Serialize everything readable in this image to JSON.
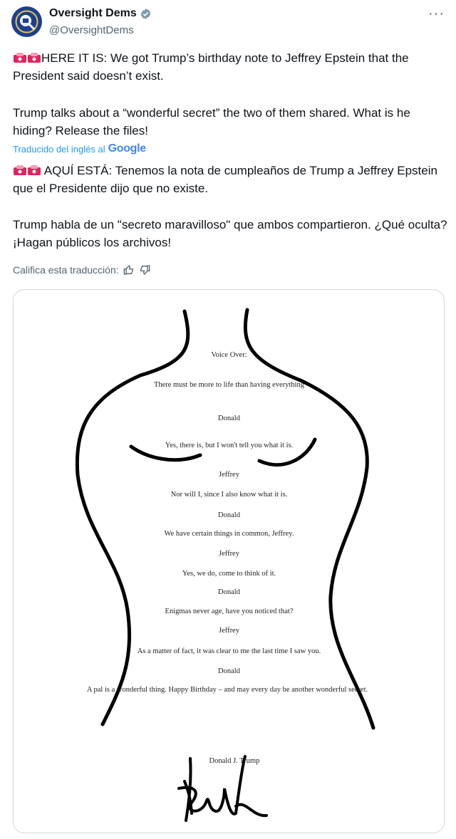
{
  "author": {
    "name": "Oversight Dems",
    "handle": "@OversightDems",
    "verified_icon": "verified-badge-icon",
    "avatar_icon": "oversight-seal-icon"
  },
  "tweet": {
    "paragraph1": "HERE IT IS: We got Trump’s birthday note to Jeffrey Epstein that the President said doesn’t exist.",
    "paragraph2": "Trump talks about a “wonderful secret” the two of them shared. What is he hiding? Release the files!",
    "translated_label": "Traducido del inglés al",
    "translated_brand": "Google",
    "translation_p1": "AQUÍ ESTÁ: Tenemos la nota de cumpleaños de Trump a Jeffrey Epstein que el Presidente dijo que no existe.",
    "translation_p2": "Trump habla de un \"secreto maravilloso\" que ambos compartieron. ¿Qué oculta? ¡Hagan públicos los archivos!",
    "rate_label": "Califica esta traducción:"
  },
  "note_image": {
    "lines": [
      "Voice Over:",
      "There must be more to life than having everything",
      "Donald",
      "Yes, there is, but I won't tell you what it is.",
      "Jeffrey",
      "Nor will I, since I also know what it is.",
      "Donald",
      "We have certain things in common, Jeffrey.",
      "Jeffrey",
      "Yes, we do, come to think of it.",
      "Donald",
      "Enigmas never age, have you noticed that?",
      "Jeffrey",
      "As a matter of fact, it was clear to me the last time I saw you.",
      "Donald",
      "A pal is a wonderful thing. Happy Birthday – and may every day be another wonderful secret.",
      "Donald J. Trump"
    ]
  },
  "colors": {
    "link_blue": "#1d9bf0",
    "muted_gray": "#536471",
    "siren_red": "#e0245e"
  }
}
